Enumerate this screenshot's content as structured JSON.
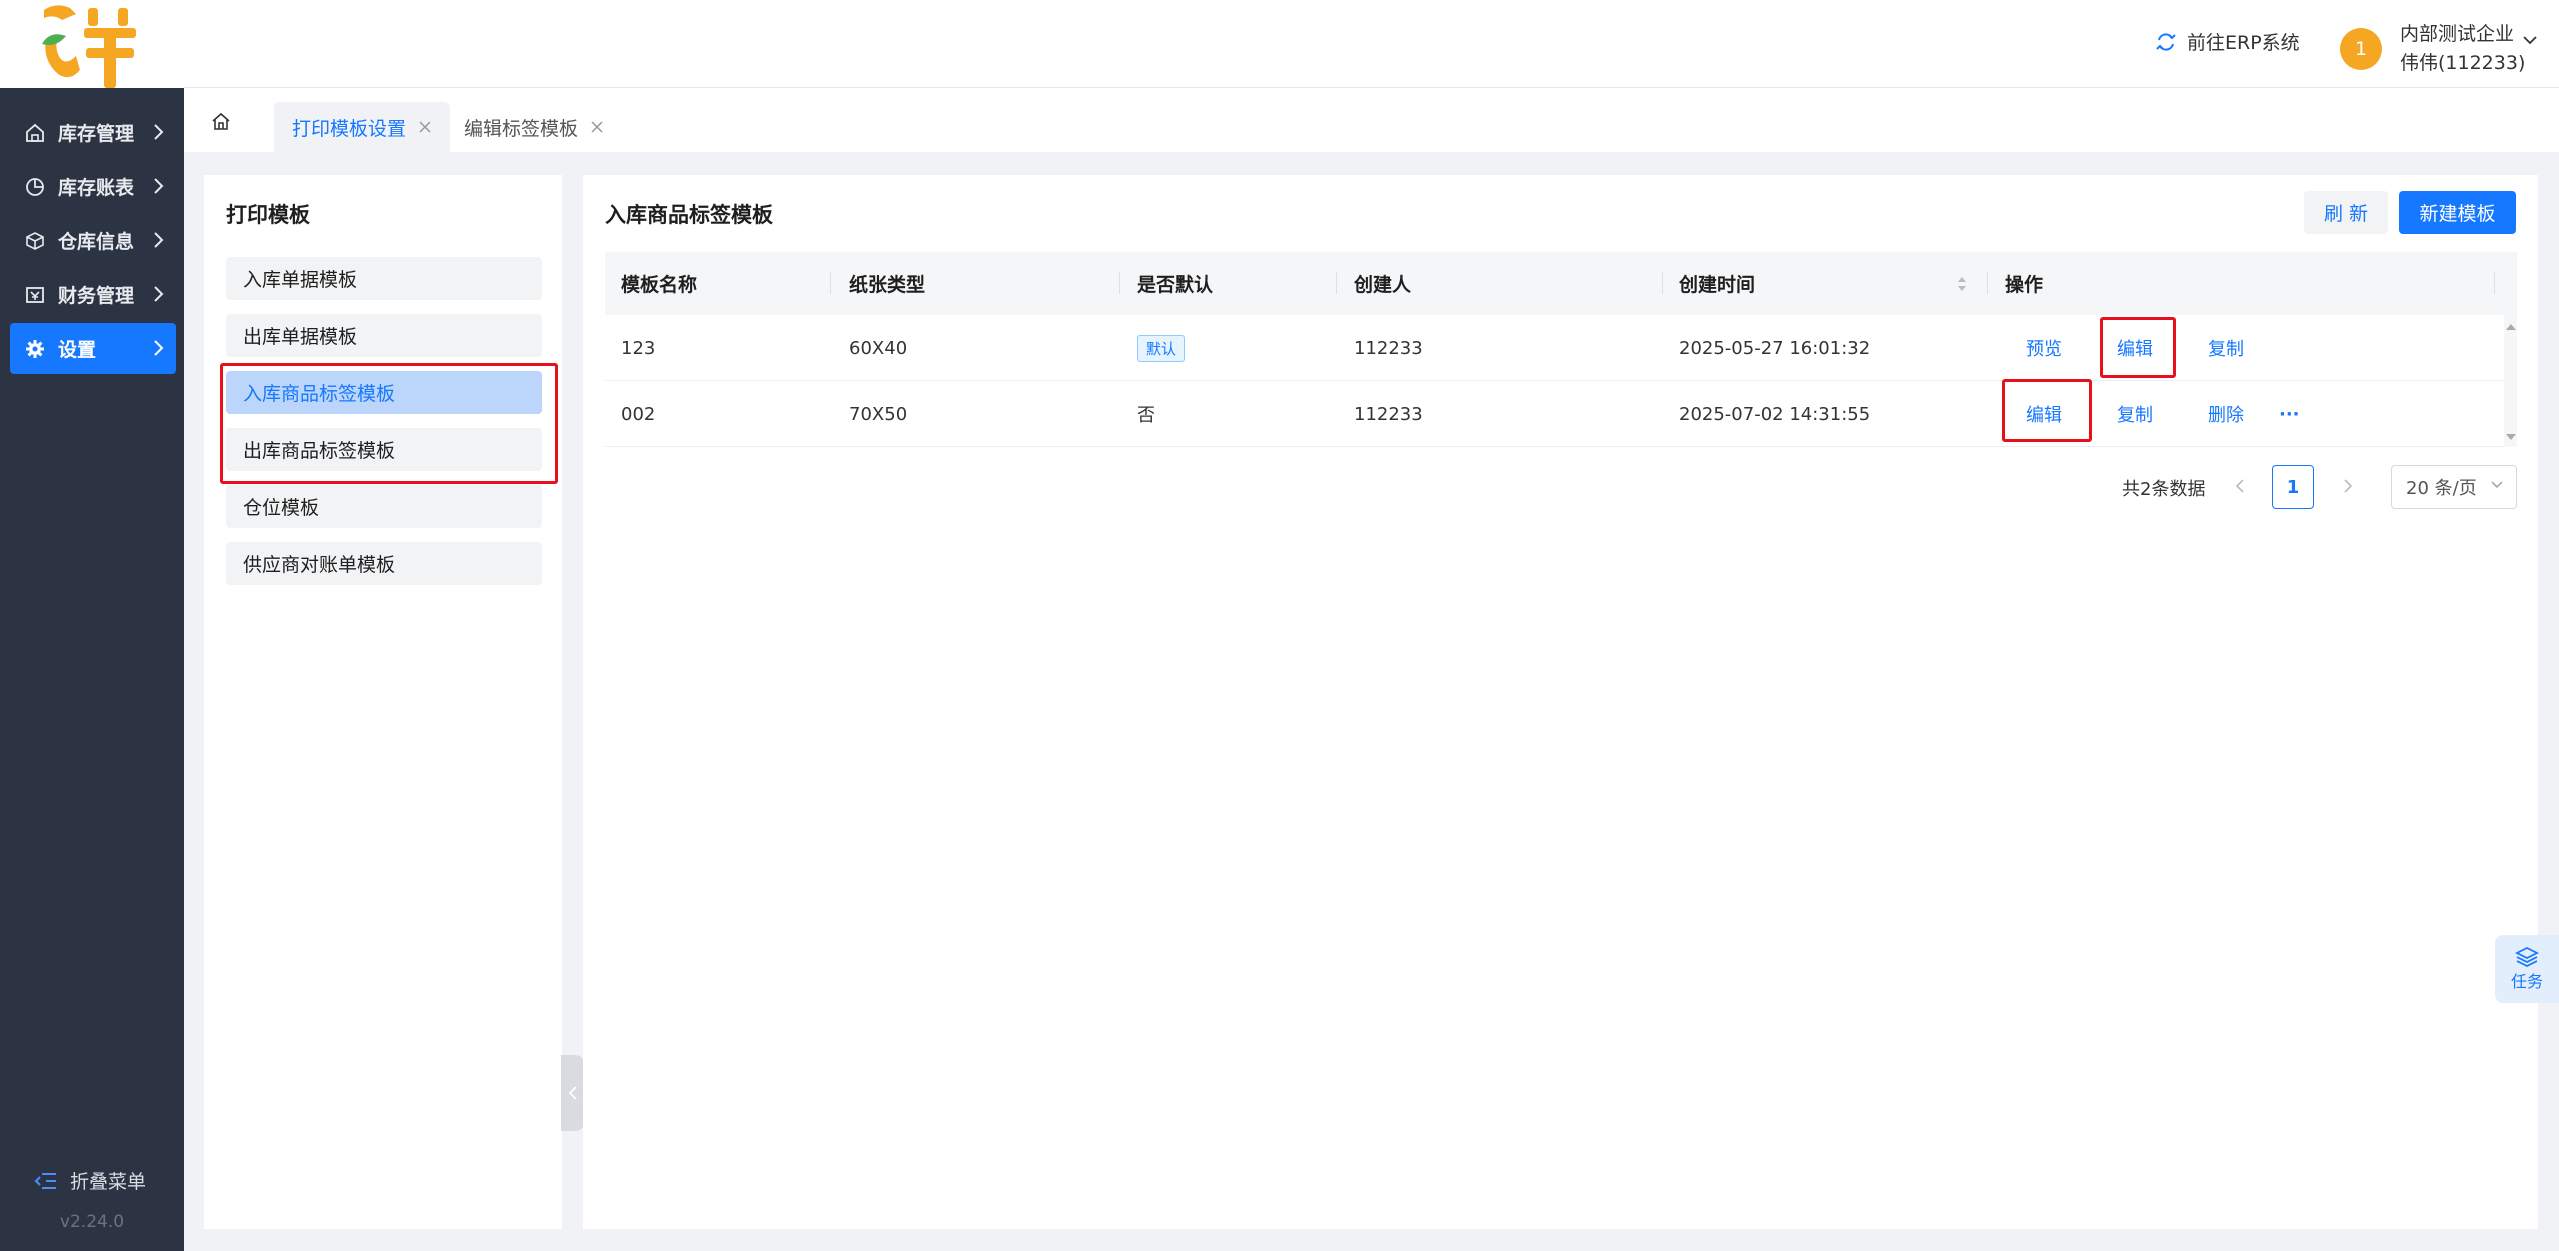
{
  "sidebar": {
    "items": [
      {
        "label": "库存管理",
        "icon": "home-stock-icon"
      },
      {
        "label": "库存账表",
        "icon": "pie-chart-icon"
      },
      {
        "label": "仓库信息",
        "icon": "cube-icon"
      },
      {
        "label": "财务管理",
        "icon": "finance-icon"
      },
      {
        "label": "设置",
        "icon": "gear-icon"
      }
    ],
    "active_index": 4,
    "collapse_label": "折叠菜单",
    "version": "v2.24.0"
  },
  "header": {
    "erp_link": "前往ERP系统",
    "avatar_text": "1",
    "company": "内部测试企业",
    "user": "伟伟(112233)"
  },
  "tabs": [
    {
      "label": "打印模板设置",
      "active": true
    },
    {
      "label": "编辑标签模板",
      "active": false
    }
  ],
  "left_panel": {
    "title": "打印模板",
    "items": [
      "入库单据模板",
      "出库单据模板",
      "入库商品标签模板",
      "出库商品标签模板",
      "仓位模板",
      "供应商对账单模板"
    ],
    "active_index": 2
  },
  "main": {
    "title": "入库商品标签模板",
    "refresh_label": "刷 新",
    "new_label": "新建模板",
    "columns": [
      "模板名称",
      "纸张类型",
      "是否默认",
      "创建人",
      "创建时间",
      "操作"
    ],
    "rows": [
      {
        "name": "123",
        "paper": "60X40",
        "default": "默认",
        "is_default": true,
        "creator": "112233",
        "created": "2025-05-27 16:01:32",
        "ops": [
          "预览",
          "编辑",
          "复制"
        ]
      },
      {
        "name": "002",
        "paper": "70X50",
        "default": "否",
        "is_default": false,
        "creator": "112233",
        "created": "2025-07-02 14:31:55",
        "ops": [
          "编辑",
          "复制",
          "删除",
          "···"
        ]
      }
    ],
    "pagination": {
      "total": "共2条数据",
      "page": "1",
      "page_size": "20 条/页"
    }
  },
  "task_widget": {
    "label": "任务"
  },
  "colors": {
    "primary": "#1677ff",
    "sidebar_bg": "#2c3443",
    "highlight_red": "#e8101a",
    "logo_orange": "#f5a623"
  }
}
